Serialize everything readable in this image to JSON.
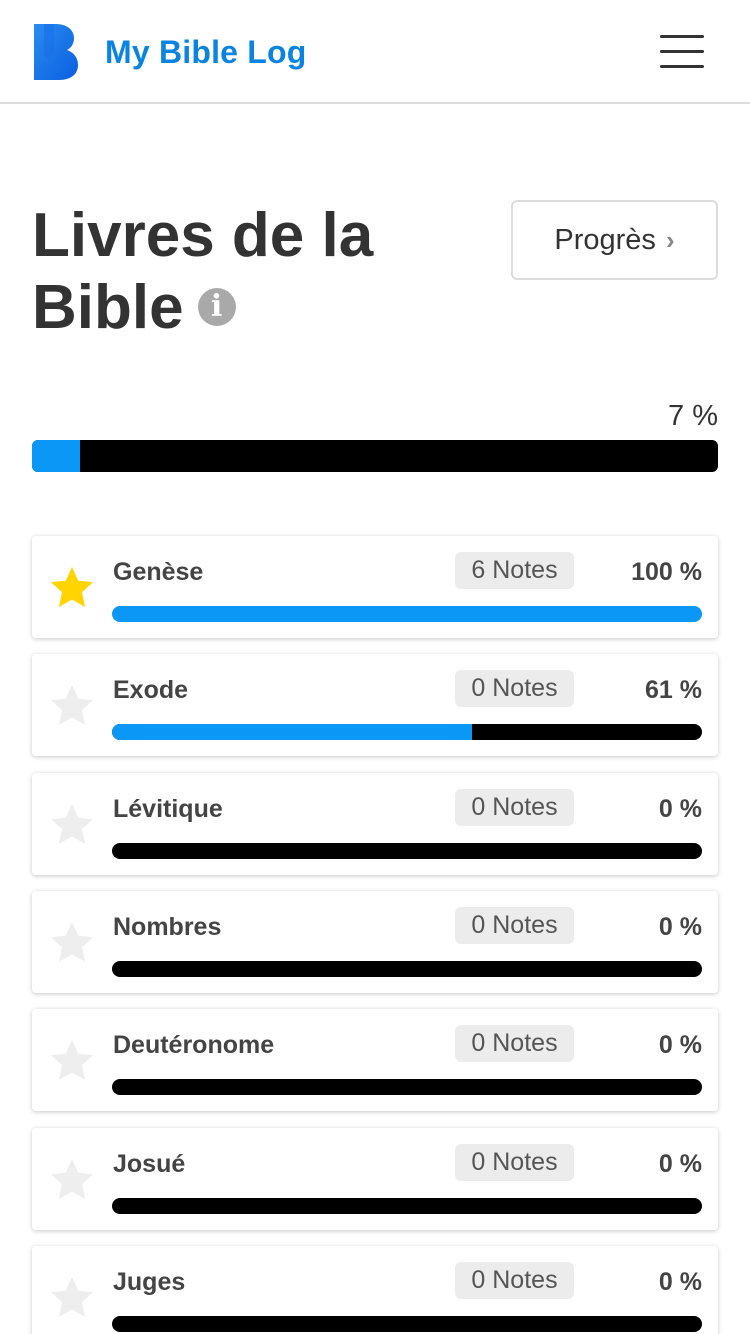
{
  "header": {
    "brand": "My Bible Log",
    "logo_icon": "bible-log-logo-icon",
    "menu_icon": "hamburger-menu-icon"
  },
  "page": {
    "title": "Livres de la Bible",
    "info_icon": "info-icon",
    "info_glyph": "i",
    "progress_button": "Progrès",
    "progress_chevron": "›"
  },
  "overall": {
    "percent_label": "7 %",
    "percent": 7
  },
  "colors": {
    "accent": "#0a97f5",
    "brand": "#0a84e0",
    "star_on": "#ffd400",
    "star_off": "#eeeeee"
  },
  "books": [
    {
      "name": "Genèse",
      "notes": "6 Notes",
      "percent_label": "100 %",
      "percent": 100,
      "starred": true
    },
    {
      "name": "Exode",
      "notes": "0 Notes",
      "percent_label": "61 %",
      "percent": 61,
      "starred": false
    },
    {
      "name": "Lévitique",
      "notes": "0 Notes",
      "percent_label": "0 %",
      "percent": 0,
      "starred": false
    },
    {
      "name": "Nombres",
      "notes": "0 Notes",
      "percent_label": "0 %",
      "percent": 0,
      "starred": false
    },
    {
      "name": "Deutéronome",
      "notes": "0 Notes",
      "percent_label": "0 %",
      "percent": 0,
      "starred": false
    },
    {
      "name": "Josué",
      "notes": "0 Notes",
      "percent_label": "0 %",
      "percent": 0,
      "starred": false
    },
    {
      "name": "Juges",
      "notes": "0 Notes",
      "percent_label": "0 %",
      "percent": 0,
      "starred": false
    }
  ]
}
